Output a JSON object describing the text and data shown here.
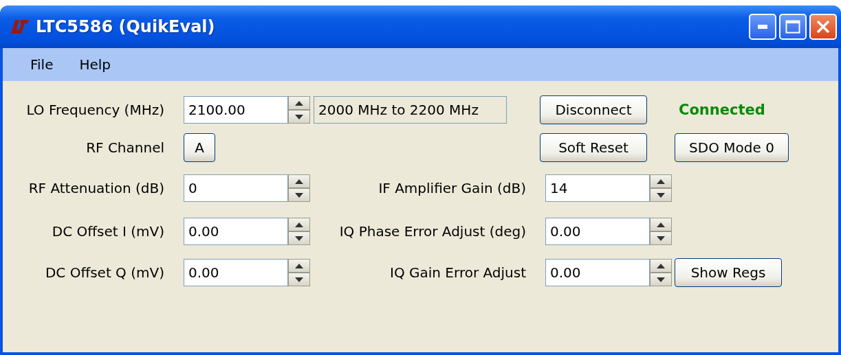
{
  "window": {
    "title": "LTC5586 (QuikEval)"
  },
  "menu": [
    {
      "label": "File"
    },
    {
      "label": "Help"
    }
  ],
  "lo_frequency": {
    "label": "LO Frequency (MHz)",
    "value": "2100.00",
    "range": "2000 MHz to 2200 MHz"
  },
  "disconnect_button": "Disconnect",
  "connection_status": "Connected",
  "rf_channel": {
    "label": "RF Channel",
    "button": "A"
  },
  "soft_reset_button": "Soft Reset",
  "sdo_mode_button": "SDO Mode 0",
  "rf_attenuation": {
    "label": "RF Attenuation (dB)",
    "value": "0"
  },
  "if_amplifier_gain": {
    "label": "IF Amplifier Gain (dB)",
    "value": "14"
  },
  "dc_offset_i": {
    "label": "DC Offset I (mV)",
    "value": "0.00"
  },
  "iq_phase_error_adjust": {
    "label": "IQ Phase Error Adjust (deg)",
    "value": "0.00"
  },
  "dc_offset_q": {
    "label": "DC Offset Q (mV)",
    "value": "0.00"
  },
  "iq_gain_error_adjust": {
    "label": "IQ Gain Error Adjust",
    "value": "0.00"
  },
  "show_regs_button": "Show Regs"
}
